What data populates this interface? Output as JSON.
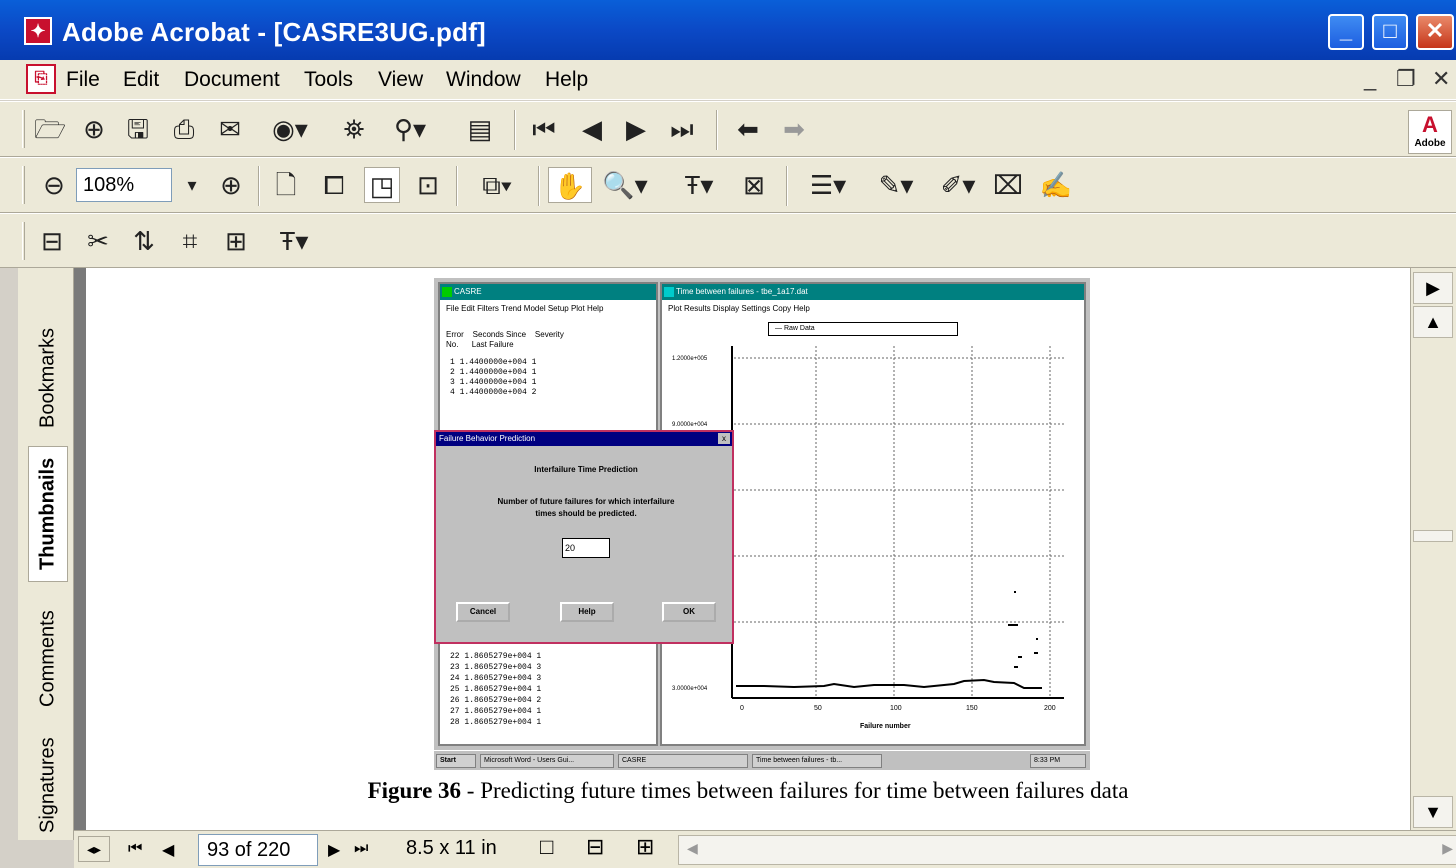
{
  "window": {
    "title": "Adobe Acrobat - [CASRE3UG.pdf]",
    "min_glyph": "_",
    "max_glyph": "□",
    "close_glyph": "✕"
  },
  "menu": {
    "items": [
      "File",
      "Edit",
      "Document",
      "Tools",
      "View",
      "Window",
      "Help"
    ],
    "mdi_min": "_",
    "mdi_restore": "❐",
    "mdi_close": "✕"
  },
  "toolbar": {
    "zoom_value": "108%",
    "adobe_logo": "A",
    "adobe_caption": "Adobe"
  },
  "nav_tabs": [
    "Bookmarks",
    "Thumbnails",
    "Comments",
    "Signatures"
  ],
  "status": {
    "page_display": "93 of 220",
    "page_size": "8.5 x 11 in"
  },
  "figure": {
    "caption_label": "Figure 36",
    "caption_text": " - Predicting future times between failures for time between failures data",
    "left_window": {
      "title": "CASRE",
      "menu": "File  Edit  Filters  Trend  Model  Setup  Plot  Help",
      "columns": "Error    Seconds Since    Severity\nNo.      Last Failure",
      "rows_top": [
        "1   1.4400000e+004   1",
        "2   1.4400000e+004   1",
        "3   1.4400000e+004   1",
        "4   1.4400000e+004   2"
      ],
      "rows_bottom": [
        "22  1.8605279e+004   1",
        "23  1.8605279e+004   3",
        "24  1.8605279e+004   3",
        "25  1.8605279e+004   1",
        "26  1.8605279e+004   2",
        "27  1.8605279e+004   1",
        "28  1.8605279e+004   1"
      ]
    },
    "right_window": {
      "title": "Time between failures - tbe_1a17.dat",
      "menu": "Plot  Results  Display  Settings  Copy  Help",
      "legend": "— Raw Data",
      "y_ticks": [
        "1.2000e+005",
        "9.0000e+004",
        "3.0000e+004"
      ],
      "x_ticks": [
        "0",
        "50",
        "100",
        "150",
        "200"
      ],
      "xlabel": "Failure number"
    },
    "dialog": {
      "title": "Failure Behavior Prediction",
      "heading": "Interfailure Time Prediction",
      "prompt_line1": "Number of future failures for which interfailure",
      "prompt_line2": "times should be predicted.",
      "input_value": "20",
      "cancel": "Cancel",
      "help": "Help",
      "ok": "OK"
    },
    "taskbar": {
      "start": "Start",
      "task1": "Microsoft Word - Users Gui...",
      "task2": "CASRE",
      "task3": "Time between failures - tb...",
      "clock": "8:33 PM"
    }
  },
  "icons": {
    "hand": "✋",
    "zoom": "🔍",
    "text": "T",
    "pen": "✎",
    "first": "⏮",
    "last": "⏭"
  }
}
